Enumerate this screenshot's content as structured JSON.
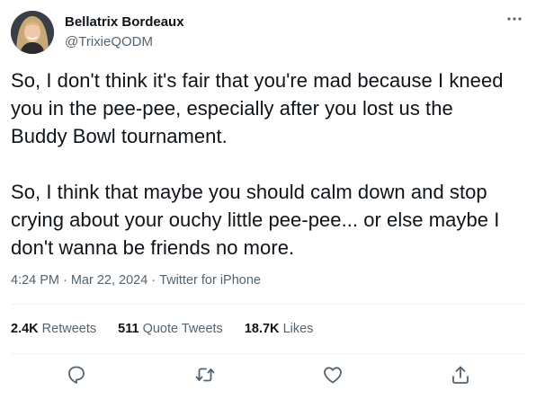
{
  "author": {
    "display_name": "Bellatrix Bordeaux",
    "handle": "@TrixieQODM"
  },
  "tweet": {
    "paragraphs": [
      "So, I don't think it's fair that you're mad because I kneed you in the pee-pee, especially after you lost us the Buddy Bowl tournament.",
      "So, I think that maybe you should calm down and stop crying about your ouchy little pee-pee... or else maybe I don't wanna be friends no more."
    ],
    "time": "4:24 PM",
    "separator": "·",
    "date": "Mar 22, 2024",
    "source": "Twitter for iPhone"
  },
  "stats": {
    "retweets": {
      "count": "2.4K",
      "label": "Retweets"
    },
    "quote_tweets": {
      "count": "511",
      "label": "Quote Tweets"
    },
    "likes": {
      "count": "18.7K",
      "label": "Likes"
    }
  },
  "icons": {
    "more": "more-horizontal-icon",
    "reply": "reply-icon",
    "retweet": "retweet-icon",
    "like": "heart-icon",
    "share": "share-icon"
  },
  "colors": {
    "text": "#0f1419",
    "secondary": "#536471",
    "divider": "#eff3f4"
  }
}
